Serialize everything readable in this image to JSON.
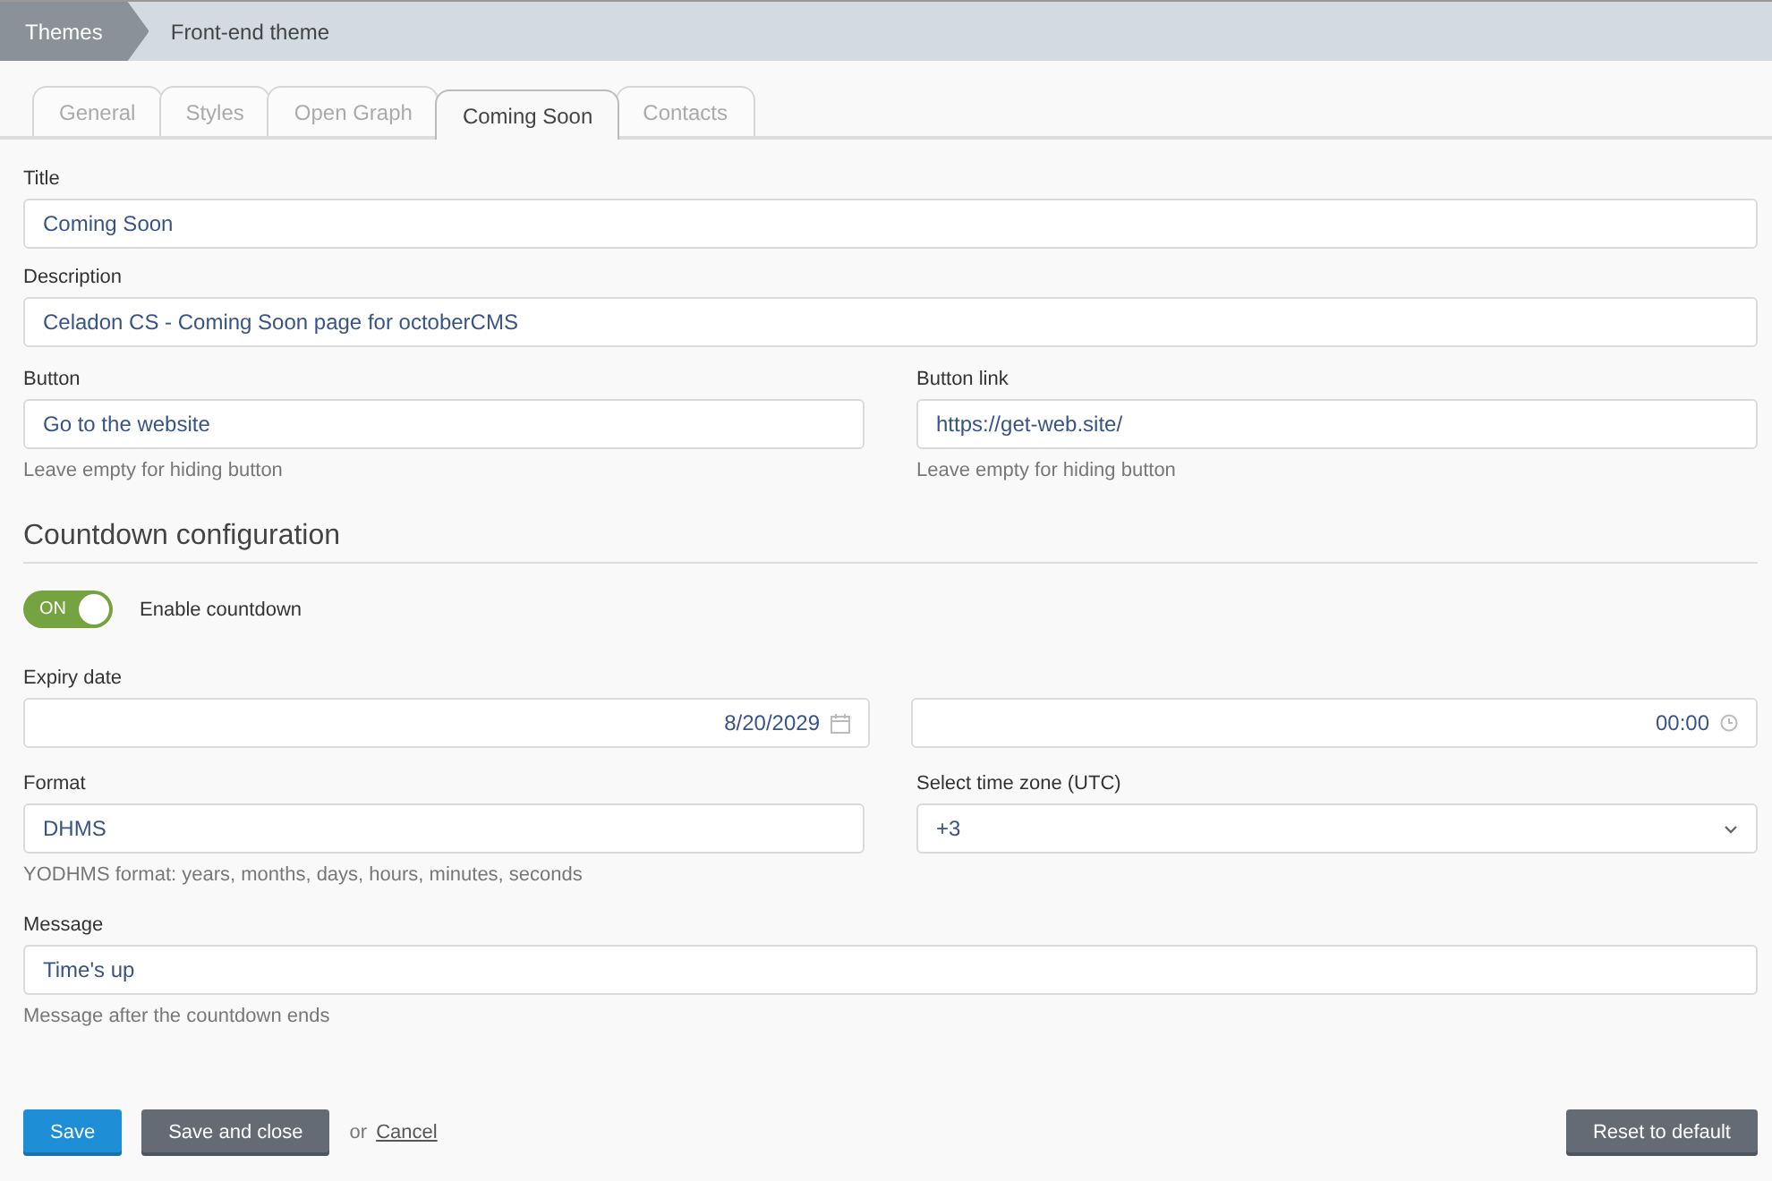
{
  "breadcrumb": [
    "Themes",
    "Front-end theme"
  ],
  "tabs": [
    {
      "label": "General",
      "selected": false
    },
    {
      "label": "Styles",
      "selected": false
    },
    {
      "label": "Open Graph",
      "selected": false
    },
    {
      "label": "Coming Soon",
      "selected": true
    },
    {
      "label": "Contacts",
      "selected": false
    }
  ],
  "title": {
    "label": "Title",
    "value": "Coming Soon"
  },
  "description": {
    "label": "Description",
    "value": "Celadon CS - Coming Soon page for octoberCMS"
  },
  "button": {
    "label": "Button",
    "value": "Go to the website",
    "help": "Leave empty for hiding button"
  },
  "button_link": {
    "label": "Button link",
    "value": "https://get-web.site/",
    "help": "Leave empty for hiding button"
  },
  "section": "Countdown configuration",
  "countdown_toggle": {
    "on": true,
    "state_label": "ON",
    "label": "Enable countdown"
  },
  "expiry": {
    "label": "Expiry date",
    "date": "8/20/2029",
    "time": "00:00"
  },
  "format": {
    "label": "Format",
    "value": "DHMS",
    "help": "YODHMS format: years, months, days, hours, minutes, seconds"
  },
  "timezone": {
    "label": "Select time zone (UTC)",
    "value": "+3"
  },
  "message": {
    "label": "Message",
    "value": "Time's up",
    "help": "Message after the countdown ends"
  },
  "actions": {
    "save": "Save",
    "save_close": "Save and close",
    "or": "or",
    "cancel": "Cancel",
    "reset": "Reset to default"
  }
}
